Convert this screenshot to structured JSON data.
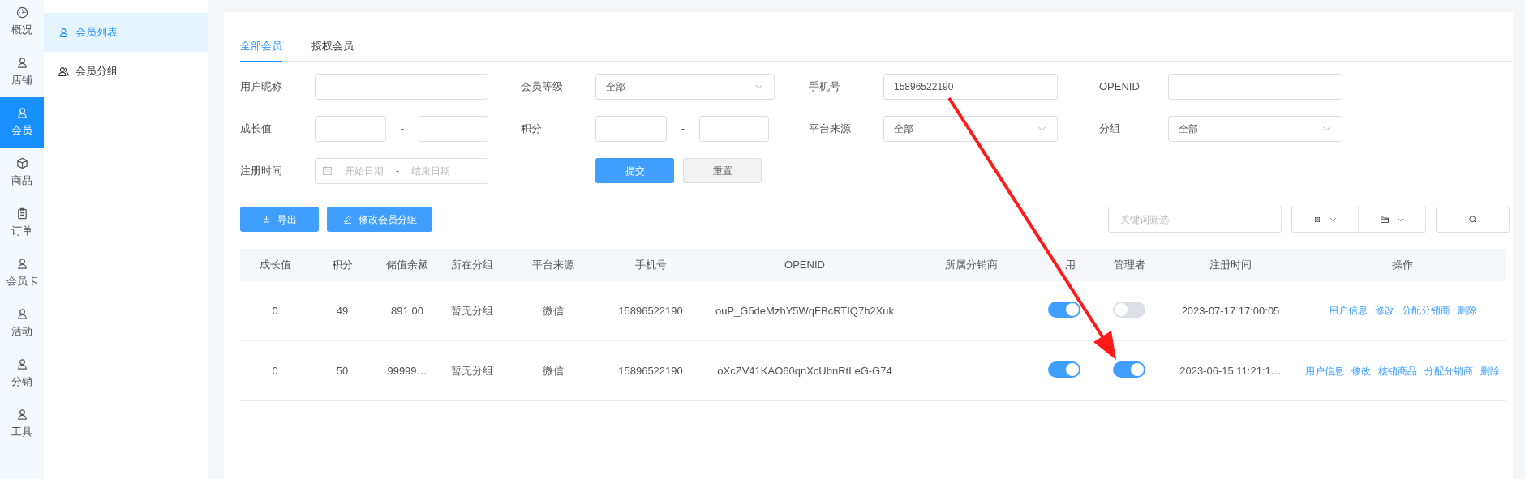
{
  "sidebar": {
    "items": [
      {
        "label": "概况",
        "selected": false
      },
      {
        "label": "店铺",
        "selected": false
      },
      {
        "label": "会员",
        "selected": true
      },
      {
        "label": "商品",
        "selected": false
      },
      {
        "label": "订单",
        "selected": false
      },
      {
        "label": "会员卡",
        "selected": false
      },
      {
        "label": "活动",
        "selected": false
      },
      {
        "label": "分销",
        "selected": false
      },
      {
        "label": "工具",
        "selected": false
      }
    ]
  },
  "submenu": {
    "items": [
      {
        "label": "会员列表",
        "selected": true
      },
      {
        "label": "会员分组",
        "selected": false
      }
    ]
  },
  "tabs": [
    {
      "label": "全部会员",
      "selected": true
    },
    {
      "label": "授权会员",
      "selected": false
    }
  ],
  "filters": {
    "nickname": {
      "label": "用户昵称"
    },
    "level": {
      "label": "会员等级",
      "value": "全部"
    },
    "phone": {
      "label": "手机号",
      "value": "15896522190"
    },
    "openid": {
      "label": "OPENID"
    },
    "growth": {
      "label": "成长值",
      "separator": "-"
    },
    "points": {
      "label": "积分",
      "separator": "-"
    },
    "source": {
      "label": "平台来源",
      "value": "全部"
    },
    "group": {
      "label": "分组",
      "value": "全部"
    },
    "reg_time": {
      "label": "注册时间",
      "start_placeholder": "开始日期",
      "separator": "-",
      "end_placeholder": "结束日期"
    },
    "submit": "提交",
    "reset": "重置"
  },
  "actions": [
    "导出",
    "修改会员分组"
  ],
  "keyword": {
    "placeholder": "关键词筛选"
  },
  "table": {
    "columns": [
      "成长值",
      "积分",
      "储值余额",
      "所在分组",
      "平台来源",
      "手机号",
      "OPENID",
      "所属分销商",
      "用",
      "管理者",
      "注册时间",
      "操作"
    ],
    "rows": [
      {
        "growth": "0",
        "points": "49",
        "balance": "891.00",
        "group": "暂无分组",
        "source": "微信",
        "phone": "15896522190",
        "openid": "ouP_G5deMzhY5WqFBcRTIQ7h2Xuk",
        "disabled": true,
        "admin": false,
        "time": "2023-07-17 17:00:05",
        "ops": [
          "用户信息",
          "修改",
          "分配分销商",
          "删除"
        ]
      },
      {
        "growth": "0",
        "points": "50",
        "balance": "99999…",
        "group": "暂无分组",
        "source": "微信",
        "phone": "15896522190",
        "openid": "oXcZV41KAO60qnXcUbnRtLeG-G74",
        "disabled": true,
        "admin": true,
        "time": "2023-06-15 11:21:1…",
        "ops": [
          "用户信息",
          "修改",
          "核销商品",
          "分配分销商",
          "删除"
        ]
      }
    ]
  }
}
